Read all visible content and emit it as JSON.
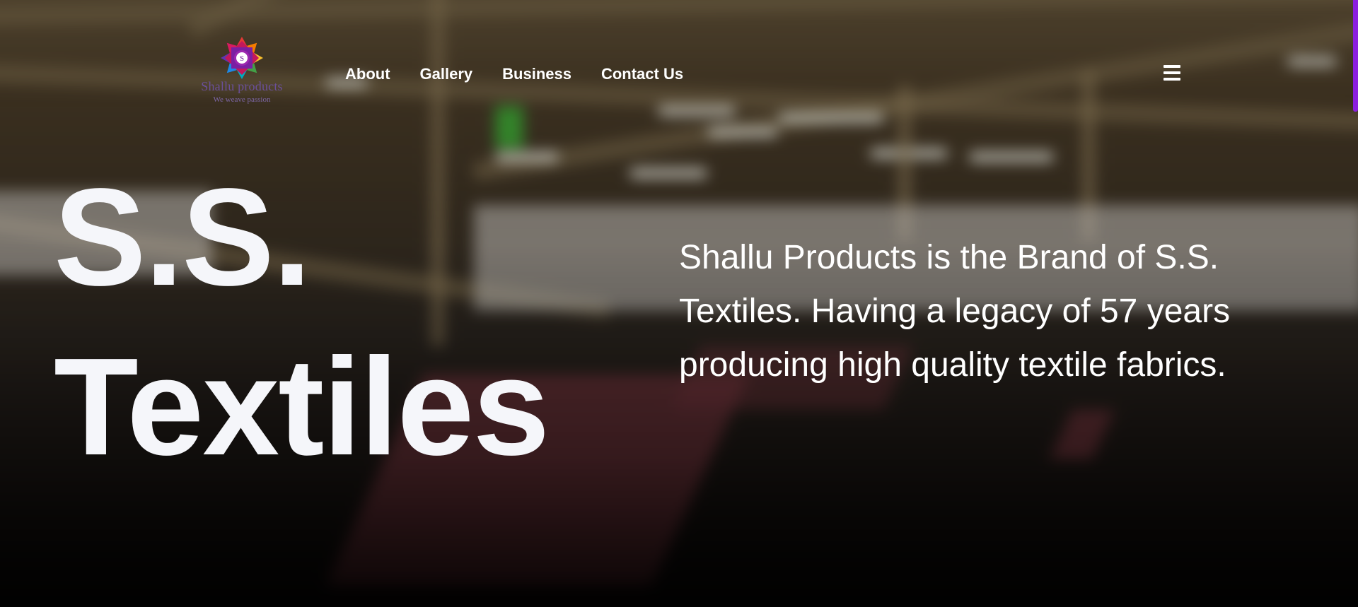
{
  "header": {
    "logo": {
      "brand": "Shallu products",
      "tagline": "We weave passion",
      "emblem_letter": "S"
    },
    "nav": [
      {
        "label": "About"
      },
      {
        "label": "Gallery"
      },
      {
        "label": "Business"
      },
      {
        "label": "Contact Us"
      }
    ],
    "menu_icon": "hamburger-menu-icon"
  },
  "hero": {
    "title_line1": "S.S.",
    "title_line2": "Textiles",
    "description": "Shallu Products is the Brand of S.S. Textiles. Having a legacy of 57 years producing high quality textile fabrics."
  },
  "colors": {
    "accent": "#8b1fe0",
    "text": "#f5f6fa",
    "logo_text": "#6a4f9a"
  }
}
